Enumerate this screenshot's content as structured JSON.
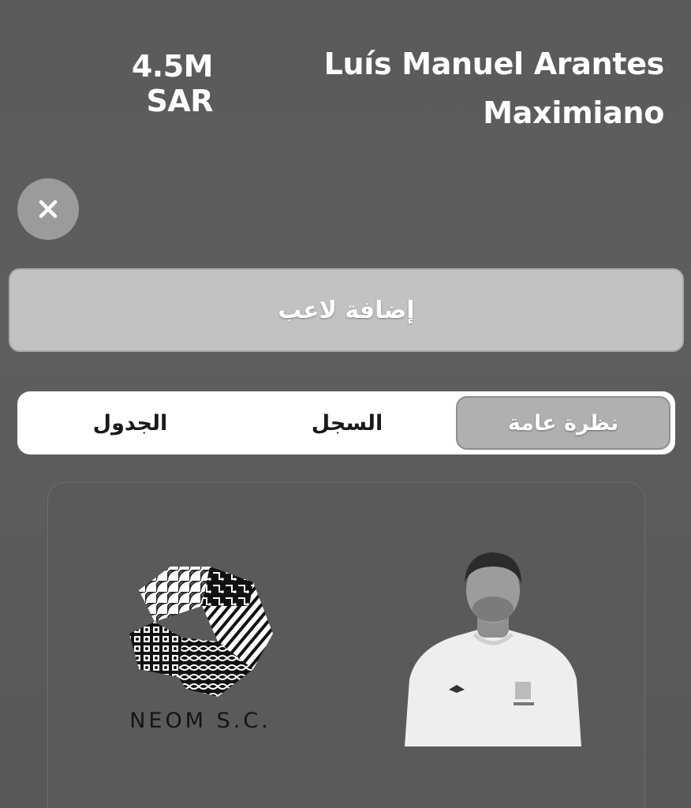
{
  "header": {
    "price_value": "4.5M",
    "price_currency": "SAR",
    "player_name_line1": "Luís Manuel Arantes",
    "player_name_line2": "Maximiano"
  },
  "actions": {
    "close_icon": "close-icon",
    "add_player_label": "إضافة لاعب"
  },
  "tabs": [
    {
      "label": "نظرة عامة",
      "active": true
    },
    {
      "label": "السجل",
      "active": false
    },
    {
      "label": "الجدول",
      "active": false
    }
  ],
  "card": {
    "club_name": "NEOM S.C.",
    "club_logo_icon": "neom-sc-crest",
    "player_photo_icon": "player-portrait"
  }
}
